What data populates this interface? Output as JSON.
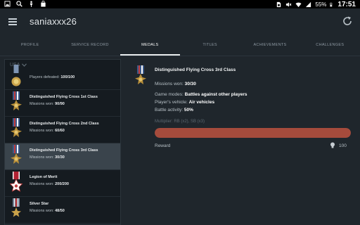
{
  "status": {
    "battery": "55%",
    "time": "17:51"
  },
  "app": {
    "title": "saniaxxx26"
  },
  "tabs": [
    {
      "label": "PROFILE"
    },
    {
      "label": "SERVICE RECORD"
    },
    {
      "label": "MEDALS"
    },
    {
      "label": "TITLES"
    },
    {
      "label": "ACHIEVEMENTS"
    },
    {
      "label": "CHALLENGES"
    }
  ],
  "country": {
    "selected": "USA"
  },
  "medals": [
    {
      "name": "",
      "sub_label": "Players defeated:",
      "sub_value": "100/100"
    },
    {
      "name": "Distinguished Flying Cross 1st Class",
      "sub_label": "Missions won:",
      "sub_value": "90/90"
    },
    {
      "name": "Distinguished Flying Cross 2nd Class",
      "sub_label": "Missions won:",
      "sub_value": "60/60"
    },
    {
      "name": "Distinguished Flying Cross 3rd Class",
      "sub_label": "Missions won:",
      "sub_value": "30/30"
    },
    {
      "name": "Legion of Merit",
      "sub_label": "Missions won:",
      "sub_value": "200/200"
    },
    {
      "name": "Silver Star",
      "sub_label": "Missions won:",
      "sub_value": "48/50"
    }
  ],
  "detail": {
    "title": "Distinguished Flying Cross 3rd Class",
    "missions_label": "Missions won:",
    "missions_value": "30/30",
    "modes_label": "Game modes:",
    "modes_value": "Battles against other players",
    "vehicle_label": "Player's vehicle:",
    "vehicle_value": "Air vehicles",
    "activity_label": "Battle activity:",
    "activity_value": "50%",
    "multiplier": "Multiplier: RB (x2), SB (x3)",
    "progress": 1.0,
    "reward_label": "Reward",
    "reward_value": "100"
  },
  "colors": {
    "progress_fill": "#a54b3c",
    "selected_row": "#3a444c"
  }
}
